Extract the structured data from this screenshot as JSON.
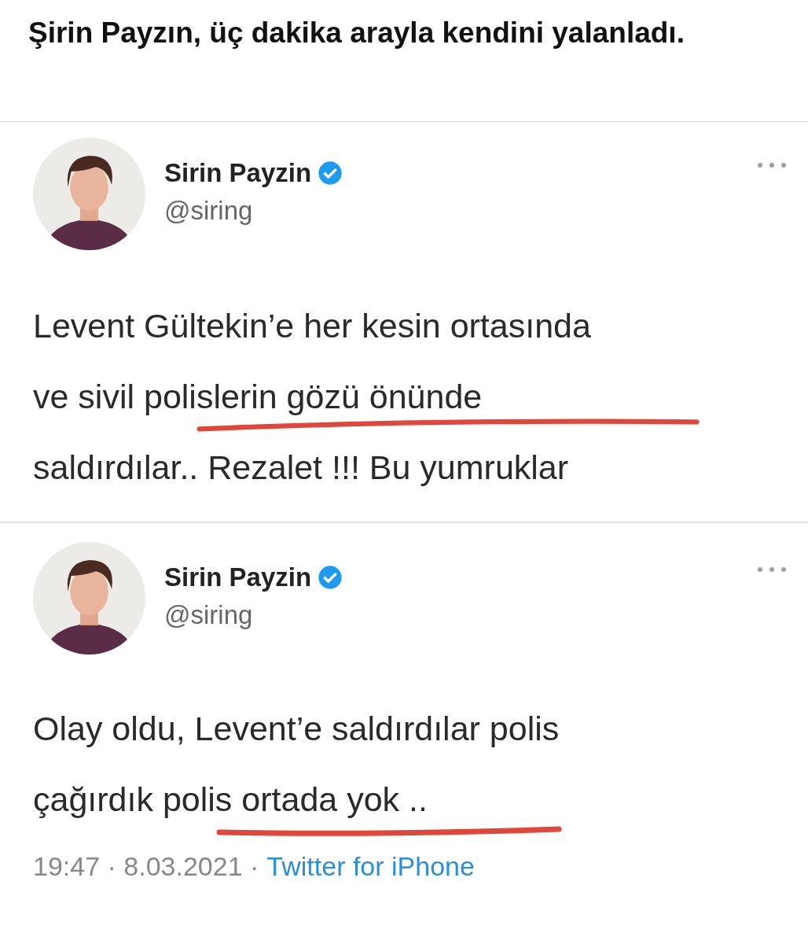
{
  "caption": "Şirin Payzın, üç dakika arayla kendini yalanladı.",
  "tweets": [
    {
      "name": "Sirin Payzin",
      "verified": true,
      "handle": "@siring",
      "lines": [
        "Levent Gültekin’e her kesin ortasında",
        "ve sivil polislerin gözü önünde",
        "saldırdılar.. Rezalet !!! Bu yumruklar"
      ]
    },
    {
      "name": "Sirin Payzin",
      "verified": true,
      "handle": "@siring",
      "lines": [
        "Olay oldu, Levent’e saldırdılar polis",
        "çağırdık polis ortada yok .."
      ],
      "time": "19:47 · 8.03.2021 ·",
      "source": "Twitter for iPhone"
    }
  ]
}
